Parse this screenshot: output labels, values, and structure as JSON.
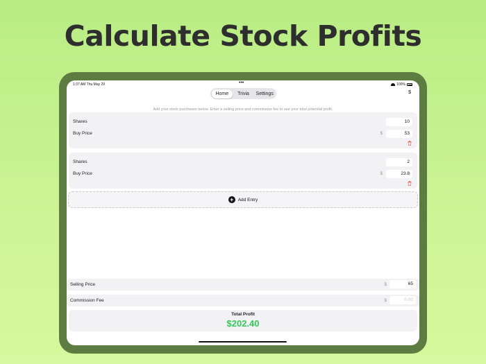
{
  "headline": "Calculate Stock Profits",
  "status": {
    "time": "1:37 AM  Thu May 29",
    "dots": "•••",
    "battery": "100%"
  },
  "tabs": [
    "Home",
    "Trivia",
    "Settings"
  ],
  "currency_symbol": "$",
  "hint": "Add your stock purchases below. Enter a selling price and commission fee to see your total potential profit.",
  "entries": [
    {
      "shares_label": "Shares",
      "shares": "10",
      "buy_label": "Buy Price",
      "dollar": "$",
      "buy_price": "53"
    },
    {
      "shares_label": "Shares",
      "shares": "2",
      "buy_label": "Buy Price",
      "dollar": "$",
      "buy_price": "23.8"
    }
  ],
  "add_entry_label": "Add Entry",
  "selling": {
    "label": "Selling Price",
    "dollar": "$",
    "value": "65"
  },
  "commission": {
    "label": "Commission Fee",
    "dollar": "$",
    "placeholder": "0.00"
  },
  "total": {
    "label": "Total Profit",
    "value": "$202.40"
  },
  "colors": {
    "background": "#c4f08c",
    "device_frame": "#5d7c42",
    "profit_green": "#34c759",
    "trash_red": "#e5534b"
  }
}
